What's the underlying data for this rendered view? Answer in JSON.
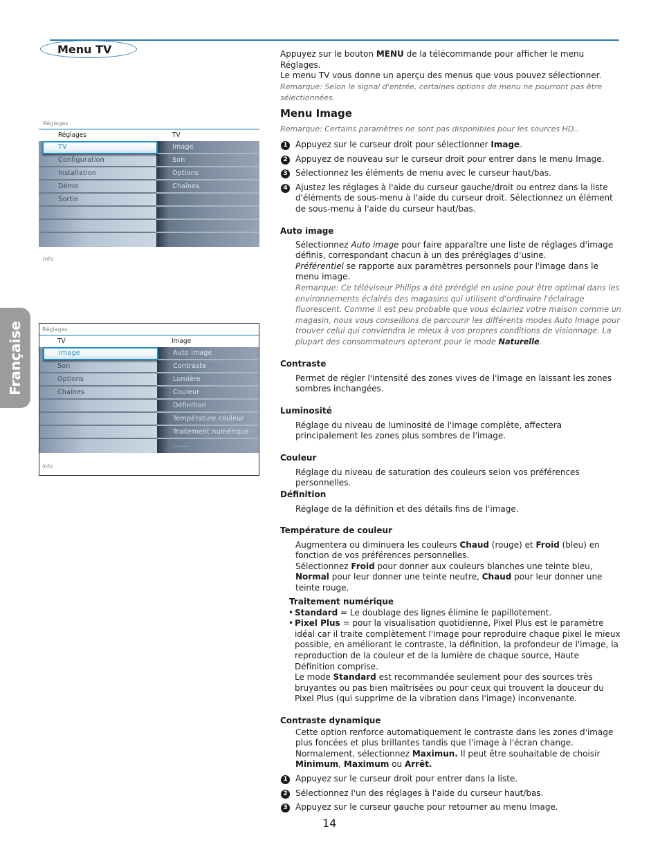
{
  "header": {
    "title": "Menu TV",
    "accent_color": "#2a7ab8"
  },
  "language_tab": {
    "label": "Française",
    "color": "#9c9c9c"
  },
  "screen1": {
    "crumb": "Réglages",
    "left_head": "Réglages",
    "right_head": "TV",
    "left_items": [
      "TV",
      "Configuration",
      "Installation",
      "Démo",
      "Sortie",
      "",
      "",
      ""
    ],
    "selected_index": 0,
    "right_items": [
      "Image",
      "Son",
      "Options",
      "Chaînes",
      "",
      "",
      "",
      ""
    ],
    "info": "Info"
  },
  "screen2": {
    "crumb": "Réglages",
    "left_head": "TV",
    "right_head": "Image",
    "left_items": [
      "Image",
      "Son",
      "Options",
      "Chaînes",
      "",
      "",
      "",
      ""
    ],
    "selected_index": 0,
    "right_items": [
      "Auto image",
      "Contraste",
      "Lumière",
      "Couleur",
      "Définition",
      "Température couleur",
      "Traitement numérique",
      "......."
    ],
    "info": "Info"
  },
  "intro": {
    "p1_a": "Appuyez sur le bouton ",
    "p1_b": "MENU",
    "p1_c": " de la télécommande pour afficher le menu Réglages.",
    "p2": "Le menu TV vous donne un aperçu des menus que vous pouvez sélectionner.",
    "note": "Remarque: Selon le signal d'entrée, certaines options de menu ne pourront pas être sélectionnées."
  },
  "menu_image": {
    "title": "Menu Image",
    "note": "Remarque: Certains paramètres ne sont pas disponibles pour les sources HD..",
    "steps": [
      {
        "num": "1",
        "text_a": "Appuyez sur le curseur droit pour sélectionner ",
        "text_b": "Image",
        "text_c": "."
      },
      {
        "num": "2",
        "text": "Appuyez de nouveau sur le curseur droit pour entrer dans le menu Image."
      },
      {
        "num": "3",
        "text": "Sélectionnez les éléments de menu avec le curseur haut/bas."
      },
      {
        "num": "4",
        "text": "Ajustez les réglages à l'aide du curseur gauche/droit ou entrez dans la liste d'éléments de sous-menu à l'aide du curseur droit. Sélectionnez un élément de sous-menu à l'aide du curseur haut/bas."
      }
    ]
  },
  "sections": {
    "auto_image": {
      "title": "Auto image",
      "p1_a": "Sélectionnez ",
      "p1_b": "Auto image",
      "p1_c": " pour faire apparaître une liste de réglages d'image définis, correspondant chacun à un des préréglages d'usine.",
      "p2_a": "Préférentiel",
      "p2_b": " se rapporte aux paramètres personnels pour l'image dans le menu image.",
      "note_a": "Remarque: Ce téléviseur Philips a été préréglé en usine pour être optimal dans les environnements éclairés des magasins qui utilisent d'ordinaire l'éclairage fluorescent. Comme il est peu probable que vous éclairiez votre maison comme un magasin, nous vous conseillons de parcourir  les différents modes Auto Image pour trouver celui qui conviendra le mieux à vos propres conditions de visionnage. La plupart des consommateurs opteront pour le mode ",
      "note_b": "Naturelle",
      "note_c": "."
    },
    "contraste": {
      "title": "Contraste",
      "text": "Permet de régler l'intensité des zones vives de l'image en laissant les zones sombres inchangées."
    },
    "luminosite": {
      "title": "Luminosité",
      "text": "Réglage du niveau de luminosité de l'image complète, affectera principalement les zones plus sombres de l'image."
    },
    "couleur": {
      "title": "Couleur",
      "text": "Réglage du niveau de saturation des couleurs selon vos préférences personnelles."
    },
    "definition": {
      "title": "Définition",
      "text": "Réglage de la définition et des détails fins de l'image."
    },
    "temperature": {
      "title": "Température de couleur",
      "p1_a": "Augmentera ou diminuera les couleurs ",
      "p1_b": "Chaud",
      "p1_c": " (rouge) et ",
      "p1_d": "Froid",
      "p1_e": " (bleu) en fonction de vos préférences personnelles.",
      "p2_a": "Sélectionnez ",
      "p2_b": "Froid",
      "p2_c": " pour donner aux couleurs blanches une teinte bleu, ",
      "p2_d": "Normal",
      "p2_e": " pour leur donner une teinte neutre, ",
      "p2_f": "Chaud",
      "p2_g": " pour leur donner une teinte rouge."
    },
    "traitement": {
      "title": "Traitement numérique",
      "b1_a": "Standard",
      "b1_b": " = Le doublage des lignes élimine le papillotement.",
      "b2_a": "Pixel Plus",
      "b2_b": " = pour la visualisation quotidienne, Pixel Plus est le paramètre idéal car il traite complètement l'image pour reproduire chaque pixel le mieux possible, en améliorant le contraste, la définition, la profondeur de l'image, la reproduction de la couleur et de la lumière de chaque source, Haute Définition comprise.",
      "p_a": "Le mode ",
      "p_b": "Standard",
      "p_c": " est recommandée seulement pour des sources très bruyantes ou pas bien maîtrisées ou pour ceux qui trouvent la douceur du Pixel Plus (qui supprime de la vibration dans l'image) inconvenante."
    },
    "contraste_dyn": {
      "title": "Contraste dynamique",
      "p1": "Cette option renforce automatiquement le contraste dans les zones d'image plus foncées et plus brillantes tandis que l'image à l'écran change.",
      "p2_a": "Normalement, sélectionnez ",
      "p2_b": "Maximun.",
      "p2_c": " Il peut être souhaitable de choisir ",
      "p2_d": "Minimum",
      "p2_e": ", ",
      "p2_f": "Maximum",
      "p2_g": " ou ",
      "p2_h": "Arrêt.",
      "steps": [
        {
          "num": "1",
          "text": "Appuyez sur le curseur droit pour entrer dans la liste."
        },
        {
          "num": "2",
          "text": "Sélectionnez l'un des réglages à l'aide du curseur haut/bas."
        },
        {
          "num": "3",
          "text": "Appuyez sur le curseur gauche pour retourner au menu Image."
        }
      ]
    }
  },
  "page_number": "14"
}
